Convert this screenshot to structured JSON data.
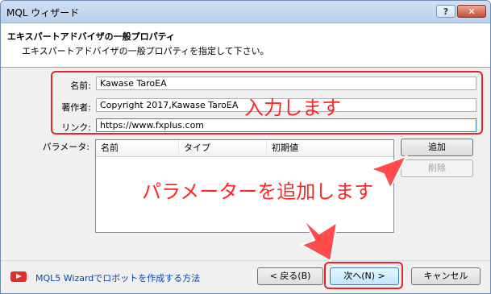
{
  "window": {
    "title": "MQL ウィザード",
    "help_label": "?",
    "close_label": "✕"
  },
  "header": {
    "title": "エキスパートアドバイザの一般プロパティ",
    "subtitle": "エキスパートアドバイザの一般プロパティを指定して下さい。"
  },
  "form": {
    "name_label": "名前:",
    "name_value": "Kawase TaroEA",
    "author_label": "著作者:",
    "author_value": "Copyright 2017,Kawase TaroEA",
    "link_label": "リンク:",
    "link_value": "https://www.fxplus.com"
  },
  "parameters": {
    "label": "パラメータ:",
    "columns": [
      "名前",
      "タイプ",
      "初期値"
    ],
    "add_label": "追加",
    "delete_label": "削除"
  },
  "annotations": {
    "input": "入力します",
    "add_params": "パラメーターを追加します",
    "color": "#ff2626"
  },
  "footer": {
    "video_link": "MQL5 Wizardでロボットを作成する方法",
    "back_label": "< 戻る(B)",
    "next_label": "次へ(N) >",
    "cancel_label": "キャンセル"
  }
}
